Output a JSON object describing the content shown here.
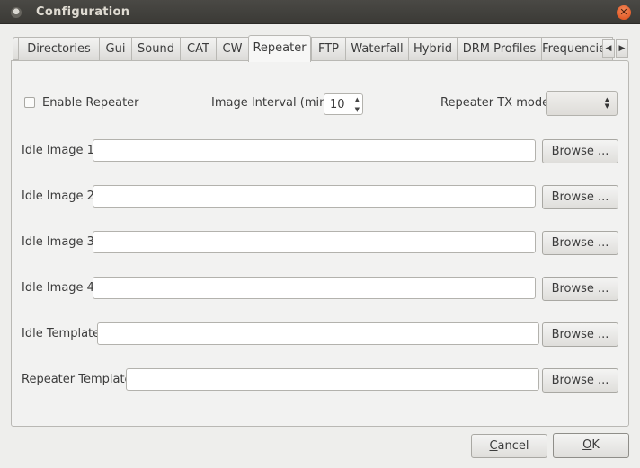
{
  "window": {
    "title": "Configuration"
  },
  "tabs": [
    {
      "label": "Directories",
      "active": false
    },
    {
      "label": "Gui",
      "active": false
    },
    {
      "label": "Sound",
      "active": false
    },
    {
      "label": "CAT",
      "active": false
    },
    {
      "label": "CW",
      "active": false
    },
    {
      "label": "Repeater",
      "active": true
    },
    {
      "label": "FTP",
      "active": false
    },
    {
      "label": "Waterfall",
      "active": false
    },
    {
      "label": "Hybrid",
      "active": false
    },
    {
      "label": "DRM Profiles",
      "active": false
    },
    {
      "label": "Frequencies",
      "active": false
    }
  ],
  "repeater": {
    "enable_label": "Enable Repeater",
    "enable_checked": false,
    "interval_label": "Image Interval (min)",
    "interval_value": "10",
    "tx_mode_label": "Repeater TX mode",
    "tx_mode_value": "",
    "rows": [
      {
        "label": "Idle Image 1",
        "value": "",
        "button": "Browse ..."
      },
      {
        "label": "Idle Image 2",
        "value": "",
        "button": "Browse ..."
      },
      {
        "label": "Idle Image 3",
        "value": "",
        "button": "Browse ..."
      },
      {
        "label": "Idle Image 4",
        "value": "",
        "button": "Browse ..."
      },
      {
        "label": "Idle Template",
        "value": "",
        "button": "Browse ..."
      },
      {
        "label": "Repeater Template",
        "value": "",
        "button": "Browse ..."
      }
    ]
  },
  "footer": {
    "cancel_mnemonic": "C",
    "cancel_rest": "ancel",
    "ok_mnemonic": "O",
    "ok_rest": "K"
  },
  "colors": {
    "titlebar": "#3c3b37",
    "close": "#df4a16",
    "window_bg": "#eeeeec"
  }
}
